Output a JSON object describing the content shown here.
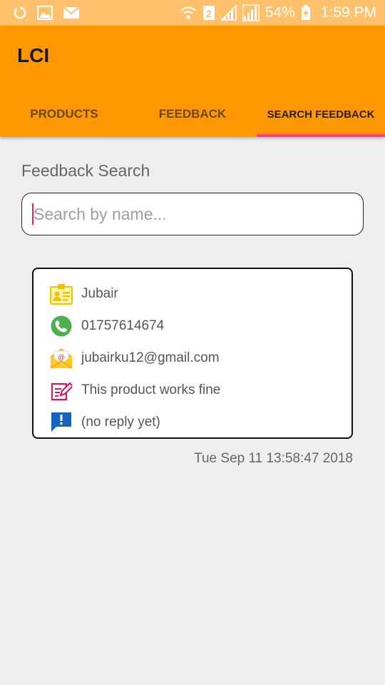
{
  "status_bar": {
    "icons_left": [
      "sync-icon",
      "image-icon",
      "mail-icon"
    ],
    "icons_right": [
      "wifi-icon",
      "sim-2-icon",
      "signal-icon",
      "signal-icon"
    ],
    "battery_percent": "54%",
    "time": "1:59 PM"
  },
  "app": {
    "title": "LCI",
    "tabs": [
      {
        "label": "PRODUCTS",
        "active": false
      },
      {
        "label": "FEEDBACK",
        "active": false
      },
      {
        "label": "SEARCH FEEDBACK",
        "active": true
      }
    ]
  },
  "search": {
    "section_label": "Feedback Search",
    "placeholder": "Search by name...",
    "value": ""
  },
  "feedback_card": {
    "name": "Jubair",
    "phone": "01757614674",
    "email": "jubairku12@gmail.com",
    "message": "This product works fine",
    "reply": "(no reply yet)",
    "icons": [
      "id-card-icon",
      "phone-icon",
      "email-icon",
      "edit-icon",
      "feedback-icon"
    ]
  },
  "timestamp": "Tue Sep 11 13:58:47 2018",
  "colors": {
    "status_bar": "#ffc16b",
    "app_bar": "#ff9800",
    "tab_indicator": "#ff4081",
    "background": "#eeeeee"
  }
}
